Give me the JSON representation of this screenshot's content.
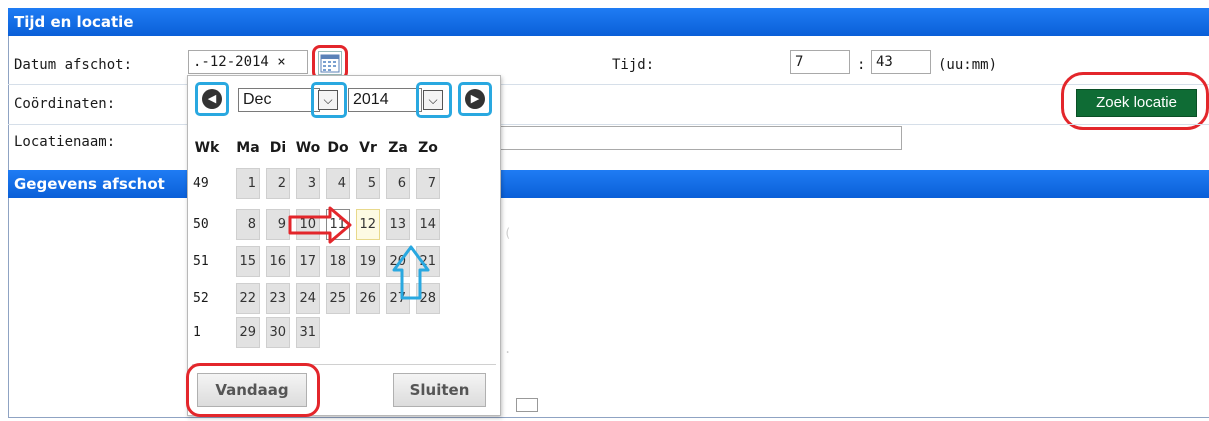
{
  "section_location": {
    "title": "Tijd en locatie",
    "date_label": "Datum afschot:",
    "date_value": ".-12-2014 ×",
    "time_label": "Tijd:",
    "hour_value": "7",
    "time_separator": ":",
    "minute_value": "43",
    "time_format_hint": "(uu:mm)",
    "coordinates_label": "Coördinaten:",
    "location_name_label": "Locatienaam:",
    "location_name_value": "",
    "search_button": "Zoek locatie"
  },
  "section_details": {
    "title": "Gegevens afschot"
  },
  "calendar": {
    "prev_icon": "chevron-left-icon",
    "next_icon": "chevron-right-icon",
    "month_value": "Dec",
    "year_value": "2014",
    "weekday_headers": [
      "Wk",
      "Ma",
      "Di",
      "Wo",
      "Do",
      "Vr",
      "Za",
      "Zo"
    ],
    "weeks": [
      {
        "wk": "49",
        "days": [
          "1",
          "2",
          "3",
          "4",
          "5",
          "6",
          "7"
        ]
      },
      {
        "wk": "50",
        "days": [
          "8",
          "9",
          "10",
          "11",
          "12",
          "13",
          "14"
        ]
      },
      {
        "wk": "51",
        "days": [
          "15",
          "16",
          "17",
          "18",
          "19",
          "20",
          "21"
        ]
      },
      {
        "wk": "52",
        "days": [
          "22",
          "23",
          "24",
          "25",
          "26",
          "27",
          "28"
        ]
      },
      {
        "wk": "1",
        "days": [
          "29",
          "30",
          "31"
        ]
      }
    ],
    "selected_day": "11",
    "today_day": "12",
    "today_button": "Vandaag",
    "close_button": "Sluiten"
  },
  "annotations": {
    "red_highlight_color": "#e3262b",
    "blue_highlight_color": "#29a8e0"
  },
  "colors": {
    "header_blue": "#0a5fd8",
    "button_green": "#0f6c35"
  }
}
